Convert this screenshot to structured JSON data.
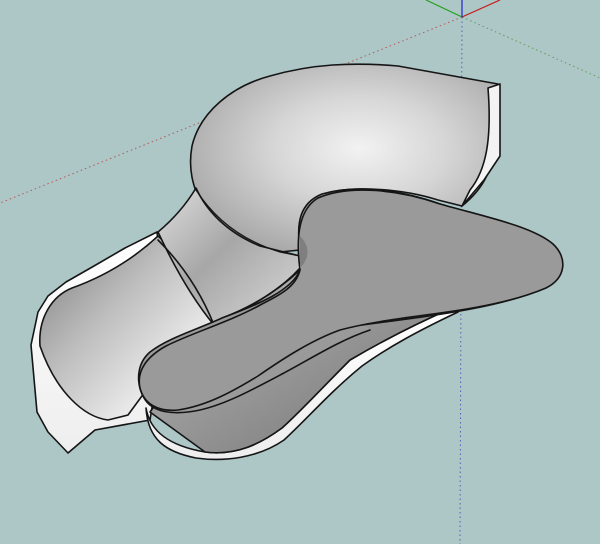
{
  "viewport": {
    "background_color": "#adc6c6",
    "axis_colors": {
      "red": "#c81818",
      "green": "#1fa31f",
      "blue": "#2424cc",
      "red_dotted": "#b45b5b",
      "green_dotted": "#5e9f5e",
      "blue_dotted": "#5c5cb8"
    },
    "model_colors": {
      "top_face": "#9a9a9a",
      "side_face": "#f3f3f3",
      "edge": "#151515"
    }
  }
}
